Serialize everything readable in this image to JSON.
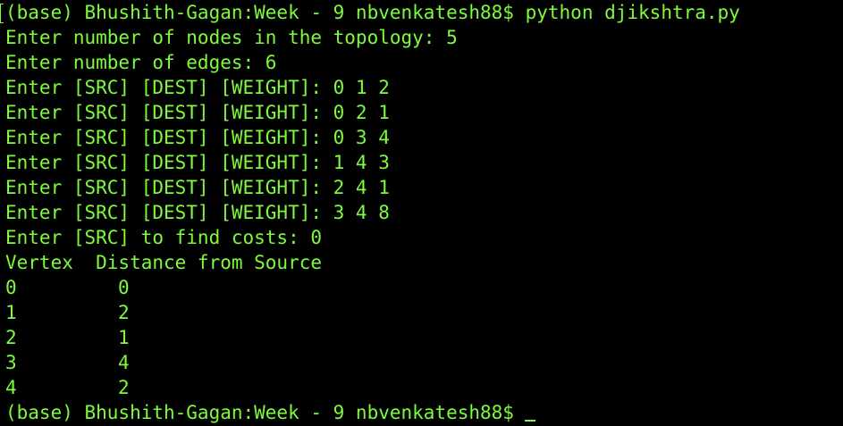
{
  "terminal": {
    "prompt": "(base) Bhushith-Gagan:Week - 9 nbvenkatesh88$",
    "command": "python djikshtra.py",
    "nodes_line": "Enter number of nodes in the topology: 5",
    "edges_line": "Enter number of edges: 6",
    "edge_inputs": [
      "Enter [SRC] [DEST] [WEIGHT]: 0 1 2",
      "Enter [SRC] [DEST] [WEIGHT]: 0 2 1",
      "Enter [SRC] [DEST] [WEIGHT]: 0 3 4",
      "Enter [SRC] [DEST] [WEIGHT]: 1 4 3",
      "Enter [SRC] [DEST] [WEIGHT]: 2 4 1",
      "Enter [SRC] [DEST] [WEIGHT]: 3 4 8"
    ],
    "src_line": "Enter [SRC] to find costs: 0",
    "table_header": "Vertex  Distance from Source",
    "rows": [
      {
        "vertex": "0",
        "distance": "0"
      },
      {
        "vertex": "1",
        "distance": "2"
      },
      {
        "vertex": "2",
        "distance": "1"
      },
      {
        "vertex": "3",
        "distance": "4"
      },
      {
        "vertex": "4",
        "distance": "2"
      }
    ],
    "final_prompt": "(base) Bhushith-Gagan:Week - 9 nbvenkatesh88$"
  },
  "colors": {
    "background": "#000000",
    "text": "#7CFC3A"
  }
}
